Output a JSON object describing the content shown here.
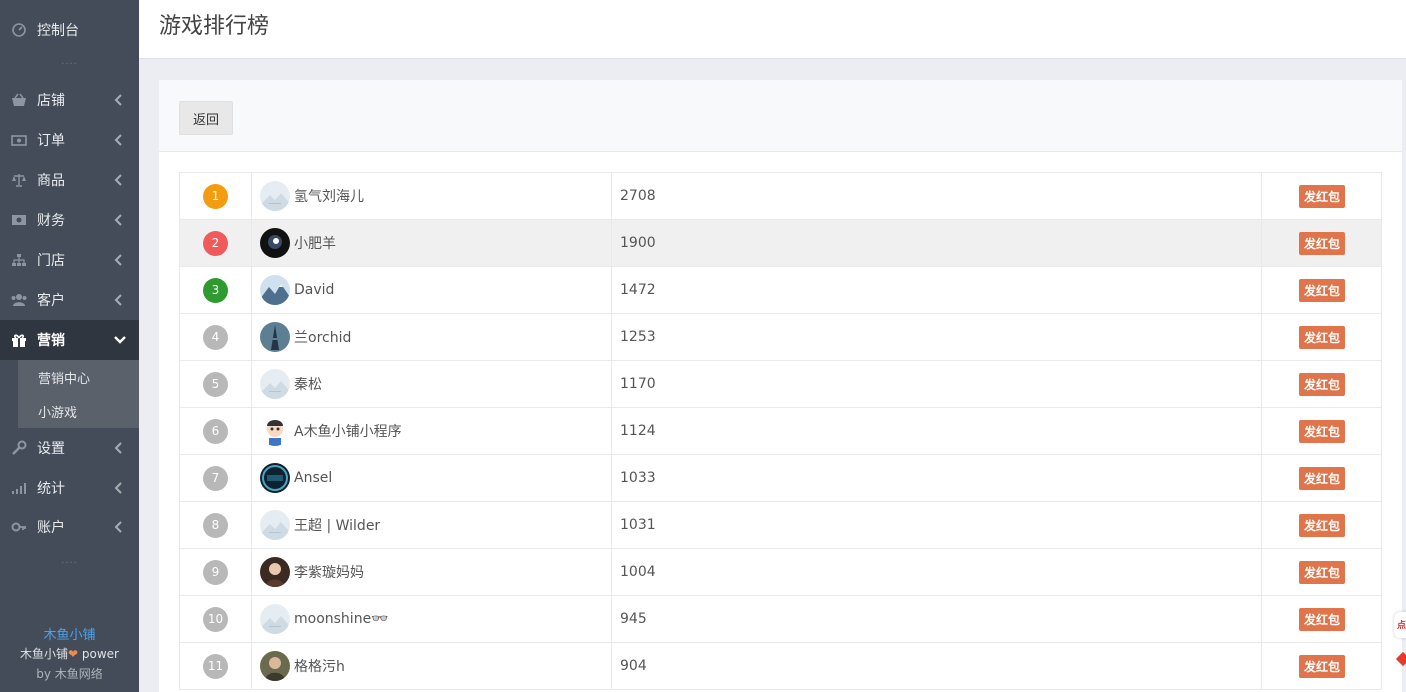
{
  "sidebar": {
    "dashboard": "控制台",
    "items": [
      {
        "label": "店铺",
        "icon": "basket-icon"
      },
      {
        "label": "订单",
        "icon": "money-icon"
      },
      {
        "label": "商品",
        "icon": "balance-scale-icon"
      },
      {
        "label": "财务",
        "icon": "cash-icon"
      },
      {
        "label": "门店",
        "icon": "sitemap-icon"
      },
      {
        "label": "客户",
        "icon": "users-icon"
      },
      {
        "label": "营销",
        "icon": "gift-icon",
        "active": true
      },
      {
        "label": "设置",
        "icon": "wrench-icon"
      },
      {
        "label": "统计",
        "icon": "signal-icon"
      },
      {
        "label": "账户",
        "icon": "key-icon"
      }
    ],
    "sub_items": [
      "营销中心",
      "小游戏"
    ],
    "brand_title": "木鱼小铺",
    "brand_power_prefix": "木鱼小铺",
    "brand_power_suffix": " power",
    "brand_by_prefix": "by ",
    "brand_by_name": "木鱼网络",
    "more_dots": "....",
    "accent_color": "#4aa3f0",
    "active_bg": "#2f3640"
  },
  "header": {
    "title": "游戏排行榜"
  },
  "toolbar": {
    "back_label": "返回"
  },
  "rows": [
    {
      "rank": "1",
      "name": "氢气刘海儿",
      "score": "2708",
      "action": "发红包",
      "rank_color": "#f39c12",
      "avatar": "placeholder"
    },
    {
      "rank": "2",
      "name": "小肥羊",
      "score": "1900",
      "action": "发红包",
      "rank_color": "#f05a5a",
      "avatar": "dark"
    },
    {
      "rank": "3",
      "name": "David",
      "score": "1472",
      "action": "发红包",
      "rank_color": "#2f9a2f",
      "avatar": "mountain"
    },
    {
      "rank": "4",
      "name": "兰orchid",
      "score": "1253",
      "action": "发红包",
      "rank_color": "#b8b8b8",
      "avatar": "tower"
    },
    {
      "rank": "5",
      "name": "秦松",
      "score": "1170",
      "action": "发红包",
      "rank_color": "#b8b8b8",
      "avatar": "placeholder"
    },
    {
      "rank": "6",
      "name": "A木鱼小铺小程序",
      "score": "1124",
      "action": "发红包",
      "rank_color": "#b8b8b8",
      "avatar": "cartoon"
    },
    {
      "rank": "7",
      "name": "Ansel",
      "score": "1033",
      "action": "发红包",
      "rank_color": "#b8b8b8",
      "avatar": "badge"
    },
    {
      "rank": "8",
      "name": "王超 | Wilder",
      "score": "1031",
      "action": "发红包",
      "rank_color": "#b8b8b8",
      "avatar": "placeholder"
    },
    {
      "rank": "9",
      "name": "李紫璇妈妈",
      "score": "1004",
      "action": "发红包",
      "rank_color": "#b8b8b8",
      "avatar": "photo"
    },
    {
      "rank": "10",
      "name": "moonshine👓",
      "score": "945",
      "action": "发红包",
      "rank_color": "#b8b8b8",
      "avatar": "placeholder"
    },
    {
      "rank": "11",
      "name": "格格污h",
      "score": "904",
      "action": "发红包",
      "rank_color": "#b8b8b8",
      "avatar": "photo2"
    }
  ],
  "float_widget_text": "点"
}
